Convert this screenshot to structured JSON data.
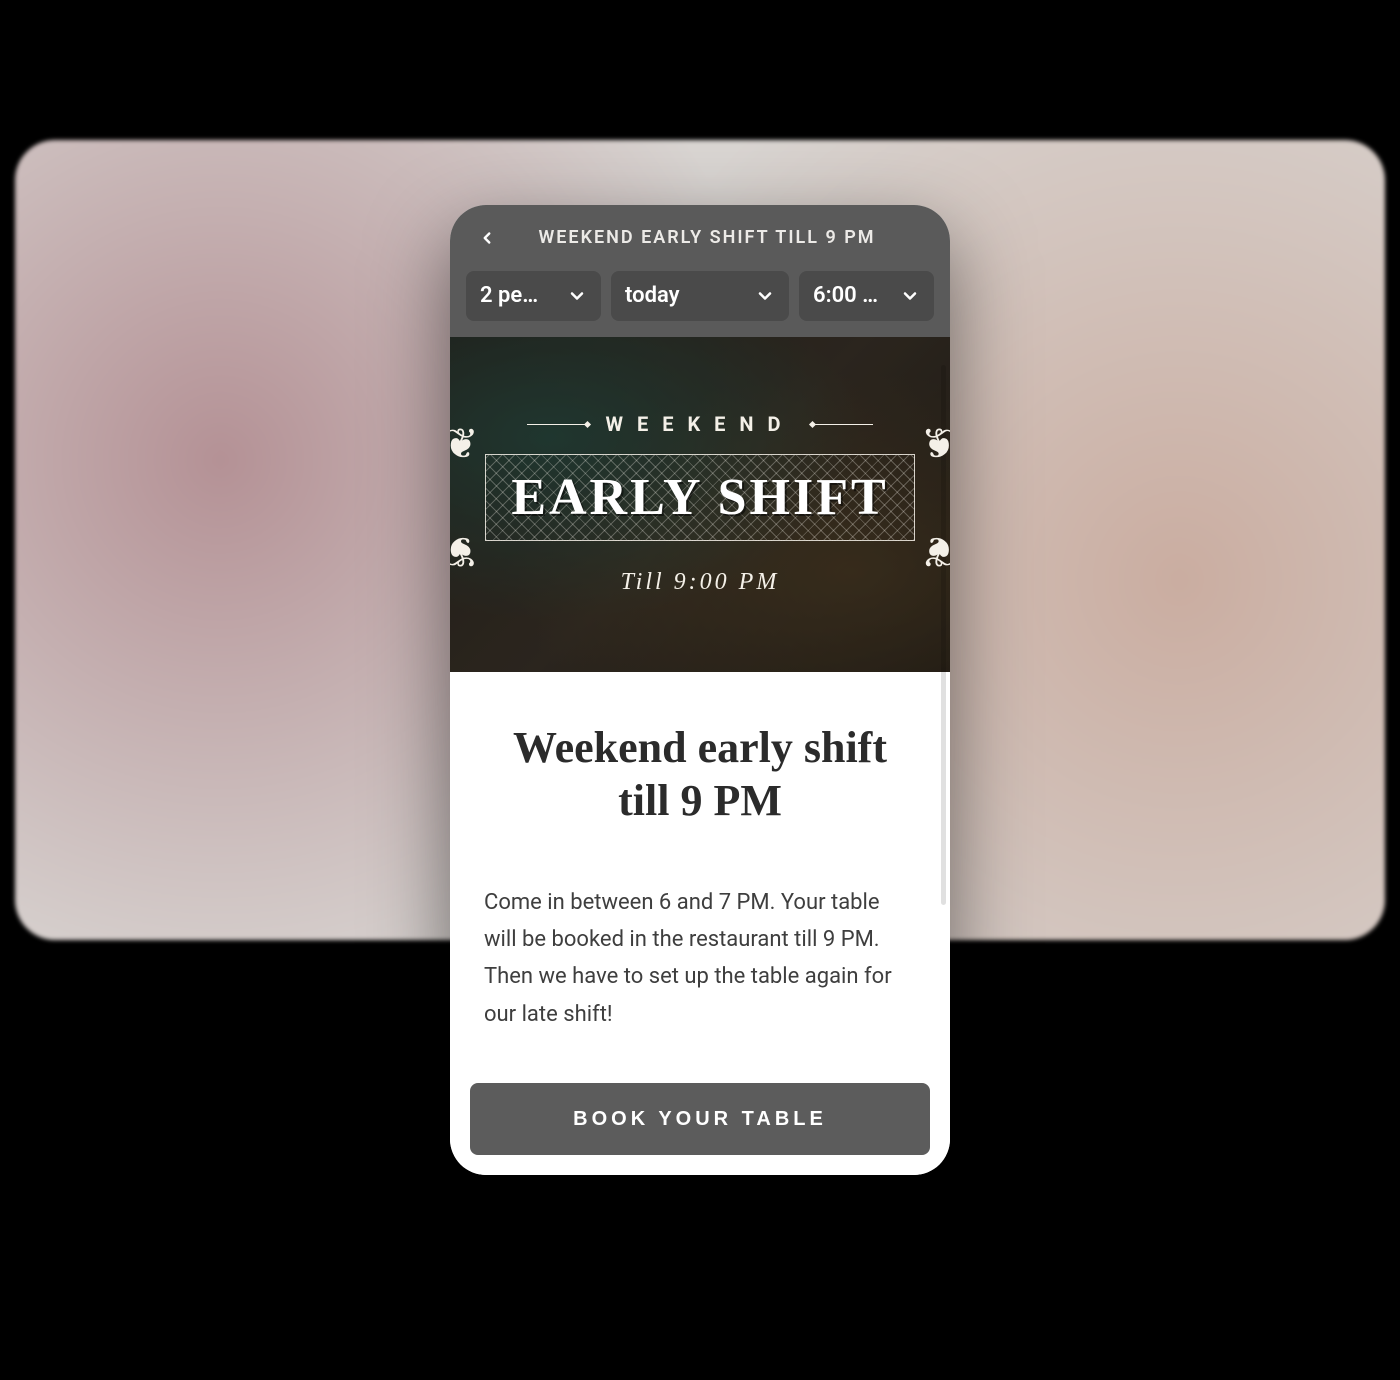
{
  "header": {
    "title": "WEEKEND EARLY SHIFT TILL 9 PM"
  },
  "selectors": {
    "people": "2 pe…",
    "date": "today",
    "time": "6:00 …"
  },
  "hero": {
    "top": "WEEKEND",
    "main": "EARLY SHIFT",
    "sub": "Till 9:00 PM"
  },
  "content": {
    "heading": "Weekend early shift till 9 PM",
    "body": "Come in between 6 and 7 PM. Your table will be booked in the restaurant till 9 PM. Then we have to set up the table again for our late shift!"
  },
  "cta": {
    "label": "BOOK YOUR TABLE"
  }
}
